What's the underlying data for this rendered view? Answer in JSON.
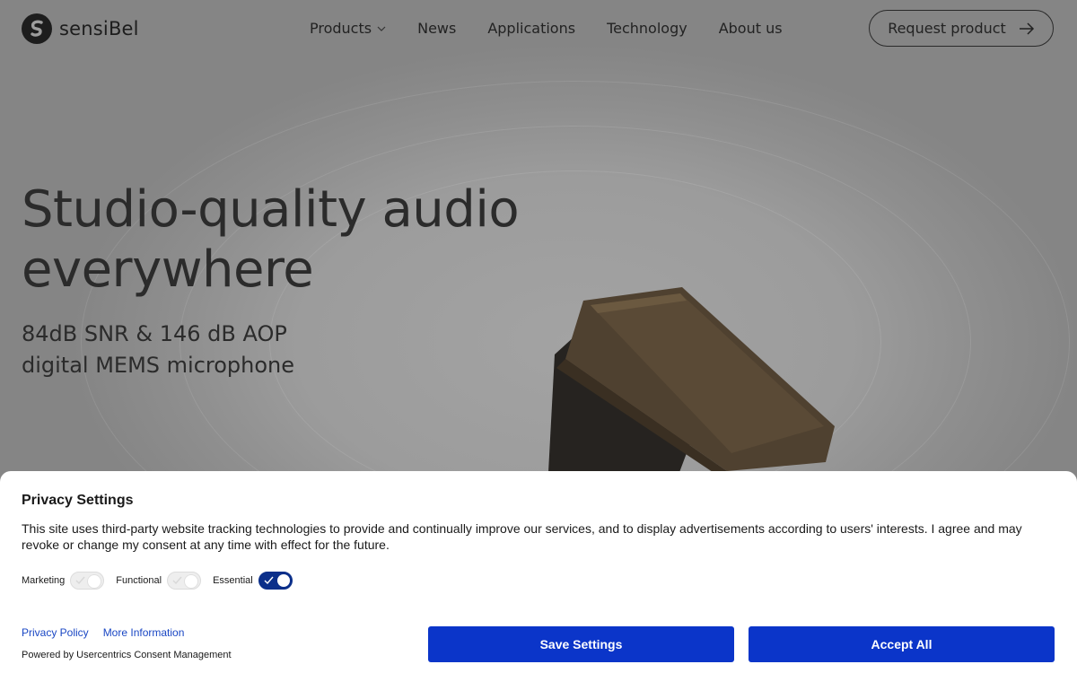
{
  "brand": {
    "name": "sensiBel"
  },
  "nav": {
    "items": [
      {
        "label": "Products",
        "has_dropdown": true
      },
      {
        "label": "News"
      },
      {
        "label": "Applications"
      },
      {
        "label": "Technology"
      },
      {
        "label": "About us"
      }
    ],
    "cta_label": "Request product"
  },
  "hero": {
    "title": "Studio-quality audio everywhere",
    "subtitle_lines": [
      "84dB SNR & 146 dB AOP",
      "digital MEMS microphone"
    ]
  },
  "consent": {
    "title": "Privacy Settings",
    "text": "This site uses third-party website tracking technologies to provide and continually improve our services, and to display advertisements according to users' interests. I agree and may revoke or change my consent at any time with effect for the future.",
    "toggles": [
      {
        "label": "Marketing",
        "on": false
      },
      {
        "label": "Functional",
        "on": false
      },
      {
        "label": "Essential",
        "on": true
      }
    ],
    "links": [
      "Privacy Policy",
      "More Information"
    ],
    "powered_by": "Powered by Usercentrics Consent Management",
    "save_label": "Save Settings",
    "accept_label": "Accept All"
  },
  "colors": {
    "overlay_background": "#9c9c9c",
    "button_primary": "#0b35c9",
    "toggle_on": "#0b2f8a",
    "link": "#1a47c4"
  }
}
